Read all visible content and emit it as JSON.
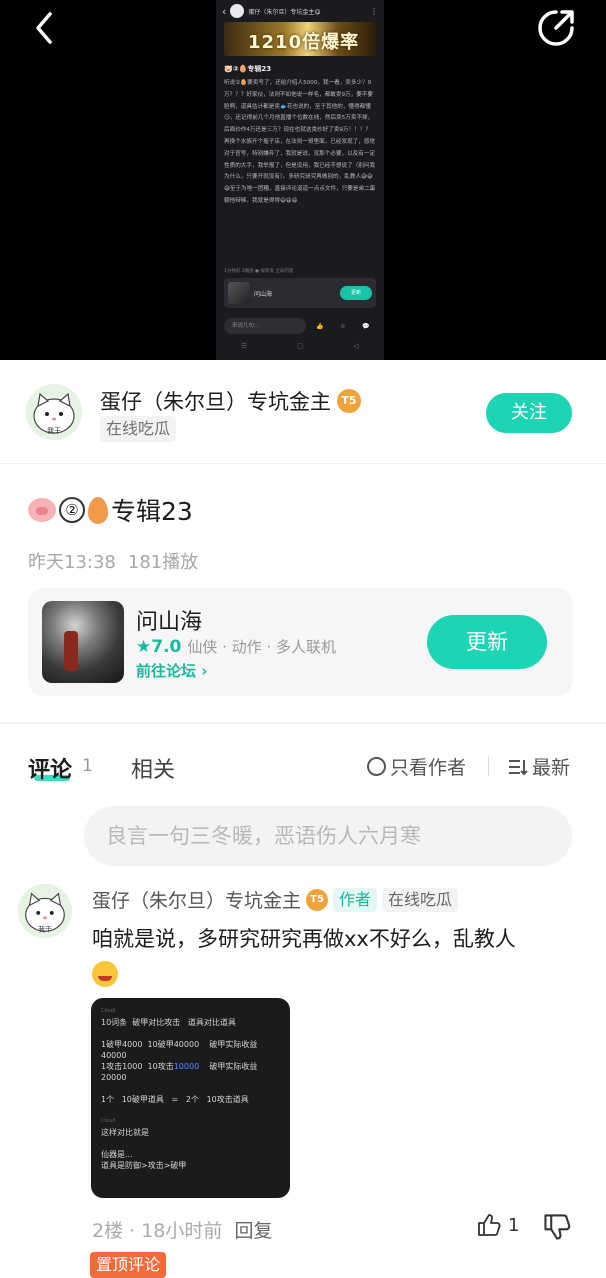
{
  "video": {
    "embedded_screen": {
      "header_name": "蛋仔（朱尔旦）专坑金主😋",
      "banner_text": "1210倍爆率",
      "title": "🐷②🥚专辑23",
      "body": "听说②🥚要卖号了，还给介绍人5000，我一看，卖多少？9万？？？好家伙，法则不如他说一样毛，都敢卖9万，要不要脸啊，道具估计都是卖🐟花也说的，至于其他的，懂得都懂😏，还记得前几个月他直播个位数在线，然后卖5万卖不掉，后面炒作4万还是三万？现在也就这类炒好了卖9万！！！？再换个水族开个摇子店，在法则一哥里面，已经发现了，感觉对于官号，特别嫌弃了，我就是说，没那个必要，以及有一定性质的大手，我举报了，但是没用，我已经不想说了（别问我为什么，只要开就没有）。多研究研究再做别的，乱教人😅😅😅至于为啥一团糟，直接评论道道一点点文件，只要是弟二蛋朝他辩够，我就是得得😄😄😄",
      "meta": "1分钟前 2播放  ● 被转发 全局内容",
      "card_title": "问山海",
      "card_button": "更新",
      "input_placeholder": "来说几句...",
      "nav": [
        "☰",
        "▢",
        "◁"
      ]
    }
  },
  "author": {
    "name": "蛋仔（朱尔旦）专坑金主",
    "level_badge": "T5",
    "status": "在线吃瓜",
    "follow_label": "关注",
    "avatar_caption": "我干"
  },
  "post": {
    "title": "专辑23",
    "circle_number": "②",
    "time": "昨天13:38",
    "plays": "181播放"
  },
  "game": {
    "name": "问山海",
    "rating": "★7.0",
    "tags": "仙侠 · 动作 · 多人联机",
    "forum_link": "前往论坛 ›",
    "update_label": "更新"
  },
  "tabs": {
    "comments_label": "评论",
    "comments_count": "1",
    "related_label": "相关",
    "author_only_label": "只看作者",
    "sort_label": "最新"
  },
  "comment_input": {
    "placeholder": "良言一句三冬暖，恶语伤人六月寒"
  },
  "comment": {
    "name": "蛋仔（朱尔旦）专坑金主",
    "level_badge": "T5",
    "author_tag": "作者",
    "status": "在线吃瓜",
    "text": "咱就是说，多研究研究再做xx不好么，乱教人",
    "image_lines": {
      "l1": "10词条  破甲对比攻击   道具对比道具",
      "l2": "1破甲4000  10破甲40000    破甲实际收益",
      "l3": "40000",
      "l4a": "1攻击1000  10攻击",
      "l4b": "10000",
      "l4c": "    破甲实际收益",
      "l5": "20000",
      "l6": "1个   10破甲道具   =   2个   10攻击道具",
      "l7": "这样对比就是",
      "l8": "仙器是...",
      "l9": "道具是防御>攻击>破甲"
    },
    "floor": "2楼",
    "time": "18小时前",
    "reply_label": "回复",
    "likes": "1",
    "pin_tag": "置顶评论"
  },
  "colors": {
    "accent": "#1dd5b4",
    "accent_text": "#1ab89d",
    "badge": "#f1a33a",
    "pin": "#f26b3a"
  }
}
